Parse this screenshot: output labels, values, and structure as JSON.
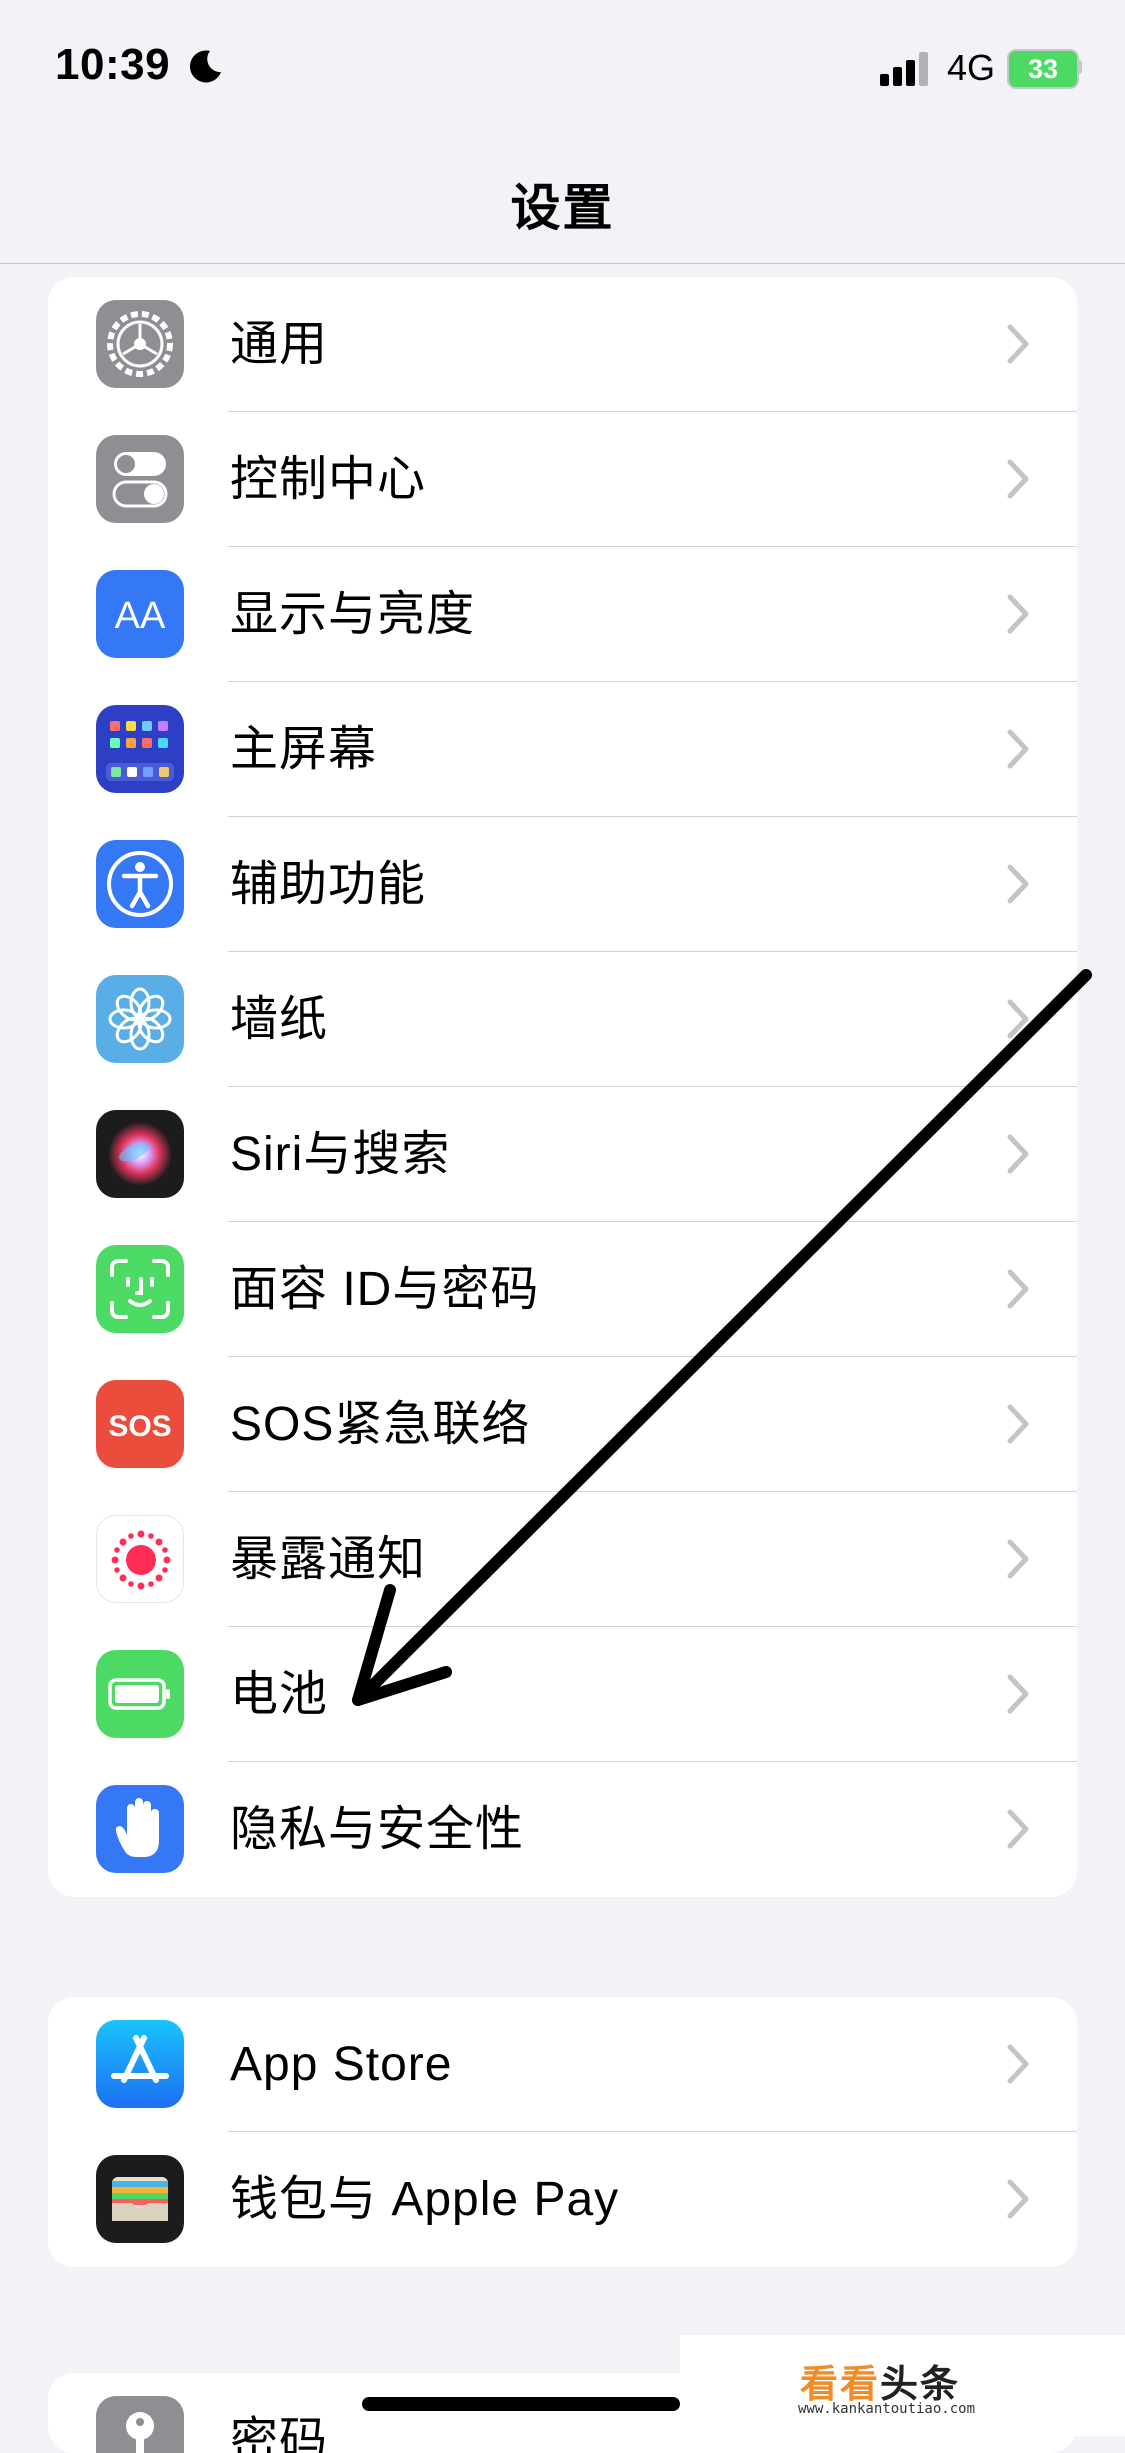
{
  "status_bar": {
    "time": "10:39",
    "network": "4G",
    "battery": "33"
  },
  "nav": {
    "title": "设置"
  },
  "group1": [
    {
      "label": "通用",
      "icon": "gear-icon",
      "color": "#8e8e93"
    },
    {
      "label": "控制中心",
      "icon": "toggles-icon",
      "color": "#8e8e93"
    },
    {
      "label": "显示与亮度",
      "icon": "text-size-icon",
      "color": "#3478f6"
    },
    {
      "label": "主屏幕",
      "icon": "home-screen-grid-icon",
      "color": "#2c3fc5"
    },
    {
      "label": "辅助功能",
      "icon": "accessibility-icon",
      "color": "#3478f6"
    },
    {
      "label": "墙纸",
      "icon": "flower-icon",
      "color": "#5ac8fa"
    },
    {
      "label": "Siri与搜索",
      "icon": "siri-icon",
      "color": "#1c1c1e"
    },
    {
      "label": "面容 ID与密码",
      "icon": "face-id-icon",
      "color": "#4cd964"
    },
    {
      "label": "SOS紧急联络",
      "icon": "sos-icon",
      "color": "#eb4d3d",
      "icon_text": "SOS"
    },
    {
      "label": "暴露通知",
      "icon": "exposure-dots-icon",
      "color": "#ff2d55"
    },
    {
      "label": "电池",
      "icon": "battery-icon",
      "color": "#4cd964"
    },
    {
      "label": "隐私与安全性",
      "icon": "hand-icon",
      "color": "#3478f6"
    }
  ],
  "group2": [
    {
      "label": "App Store",
      "icon": "app-store-icon",
      "color": "#1e90ff"
    },
    {
      "label": "钱包与 Apple Pay",
      "icon": "wallet-icon",
      "color": "#1c1c1e"
    }
  ],
  "group3": [
    {
      "label": "密码",
      "icon": "key-icon",
      "color": "#8e8e93"
    }
  ],
  "watermark": {
    "title_orange": "看看",
    "title_dark": "头条",
    "url": "www.kankantoutiao.com"
  }
}
